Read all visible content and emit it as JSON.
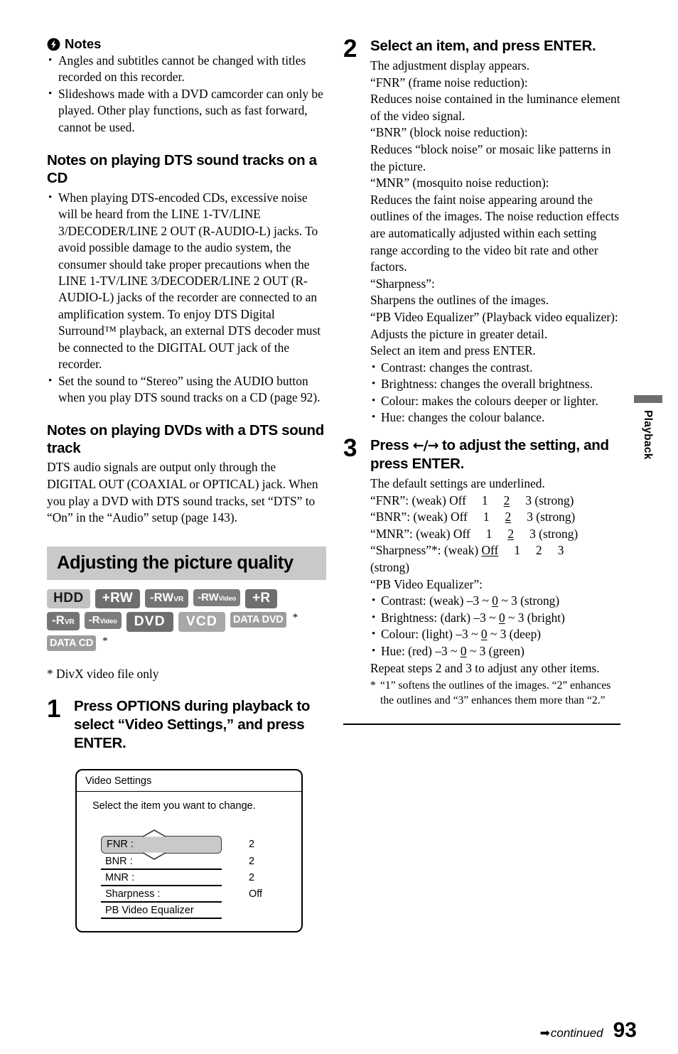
{
  "page": {
    "number": "93",
    "continued_label": "continued",
    "continued_icon": "right-arrow-icon",
    "side_tab_label": "Playback"
  },
  "left_column": {
    "notes_block": {
      "icon": "note-bolt-icon",
      "title": "Notes",
      "items": [
        "Angles and subtitles cannot be changed with titles recorded on this recorder.",
        "Slideshows made with a DVD camcorder can only be played. Other play functions, such as fast forward, cannot be used."
      ]
    },
    "dts_cd_section": {
      "heading": "Notes on playing DTS sound tracks on a CD",
      "items": [
        "When playing DTS-encoded CDs, excessive noise will be heard from the LINE 1-TV/LINE 3/DECODER/LINE 2 OUT (R-AUDIO-L) jacks. To avoid possible damage to the audio system, the consumer should take proper precautions when the LINE 1-TV/LINE 3/DECODER/LINE 2 OUT (R-AUDIO-L) jacks of the recorder are connected to an amplification system. To enjoy DTS Digital Surround™ playback, an external DTS decoder must be connected to the DIGITAL OUT jack of the recorder.",
        "Set the sound to “Stereo” using the AUDIO button when you play DTS sound tracks on a CD (page 92)."
      ]
    },
    "dts_dvd_section": {
      "heading": "Notes on playing DVDs with a DTS sound track",
      "body": "DTS audio signals are output only through the DIGITAL OUT (COAXIAL or OPTICAL) jack. When you play a DVD with DTS sound tracks, set “DTS” to “On” in the “Audio” setup (page 143)."
    },
    "banner_heading": "Adjusting the picture quality",
    "disc_badges": [
      {
        "label": "HDD",
        "style": "b-hdd",
        "star": false
      },
      {
        "label": "+RW",
        "style": "b-dark",
        "star": false
      },
      {
        "label": "-RW",
        "sub": "VR",
        "style": "b-mid",
        "star": false
      },
      {
        "label": "-RW",
        "sub": "Video",
        "style": "b-small",
        "star": false
      },
      {
        "label": "+R",
        "style": "b-dark",
        "star": false
      },
      {
        "label": "-R",
        "sub": "VR",
        "style": "b-mid",
        "star": false
      },
      {
        "label": "-R",
        "sub": "Video",
        "style": "b-small",
        "star": false
      },
      {
        "label": "DVD",
        "style": "b-dvd",
        "star": false
      },
      {
        "label": "VCD",
        "style": "b-vcd",
        "star": false
      },
      {
        "label": "DATA DVD",
        "style": "b-data",
        "star": true
      },
      {
        "label": "DATA CD",
        "style": "b-data",
        "star": true
      }
    ],
    "divx_footnote": "* DivX video file only",
    "step1": {
      "number": "1",
      "title": "Press OPTIONS during playback to select “Video Settings,” and press ENTER."
    },
    "video_settings_dialog": {
      "title": "Video Settings",
      "subtitle": "Select the item you want to change.",
      "rows": [
        {
          "label": "FNR :",
          "value": "2",
          "selected": true
        },
        {
          "label": "BNR :",
          "value": "2",
          "selected": false
        },
        {
          "label": "MNR :",
          "value": "2",
          "selected": false
        },
        {
          "label": "Sharpness :",
          "value": "Off",
          "selected": false
        },
        {
          "label": "PB Video Equalizer",
          "value": "",
          "selected": false
        }
      ]
    }
  },
  "right_column": {
    "step2": {
      "number": "2",
      "title": "Select an item, and press ENTER.",
      "lines": [
        "The adjustment display appears.",
        "“FNR” (frame noise reduction):",
        "Reduces noise contained in the luminance element of the video signal.",
        "“BNR” (block noise reduction):",
        "Reduces “block noise” or mosaic like patterns in the picture.",
        "“MNR” (mosquito noise reduction):",
        "Reduces the faint noise appearing around the outlines of the images. The noise reduction effects are automatically adjusted within each setting range according to the video bit rate and other factors.",
        "“Sharpness”:",
        "Sharpens the outlines of the images.",
        "“PB Video Equalizer” (Playback video equalizer):",
        "Adjusts the picture in greater detail.",
        "Select an item and press ENTER."
      ],
      "bullets": [
        "Contrast: changes the contrast.",
        "Brightness: changes the overall brightness.",
        "Colour: makes the colours deeper or lighter.",
        "Hue: changes the colour balance."
      ]
    },
    "step3": {
      "number": "3",
      "title_pre": "Press ",
      "title_arrows": "←/→",
      "title_post": " to adjust the setting, and press ENTER.",
      "intro": "The default settings are underlined.",
      "settings": [
        {
          "name": "“FNR”:",
          "low": "(weak) Off",
          "opt1": "1",
          "opt2": "2",
          "opt3": "3 (strong)",
          "default_index": 2
        },
        {
          "name": "“BNR”:",
          "low": "(weak) Off",
          "opt1": "1",
          "opt2": "2",
          "opt3": "3 (strong)",
          "default_index": 2
        },
        {
          "name": "“MNR”:",
          "low": "(weak) Off",
          "opt1": "1",
          "opt2": "2",
          "opt3": "3 (strong)",
          "default_index": 2
        },
        {
          "name": "“Sharpness”*:",
          "low": "(weak)",
          "opt0": "Off",
          "opt1": "1",
          "opt2": "2",
          "opt3": "3",
          "tail": "(strong)",
          "default_index": 0
        }
      ],
      "equalizer_title": "“PB Video Equalizer”:",
      "equalizer": [
        {
          "label": "Contrast:",
          "low": "(weak) –3",
          "mid": "0",
          "high": "3 (strong)"
        },
        {
          "label": "Brightness:",
          "low": "(dark) –3",
          "mid": "0",
          "high": "3 (bright)"
        },
        {
          "label": "Colour:",
          "low": "(light) –3",
          "mid": "0",
          "high": "3 (deep)"
        },
        {
          "label": "Hue:",
          "low": "(red) –3",
          "mid": "0",
          "high": "3 (green)"
        }
      ],
      "repeat_note": "Repeat steps 2 and 3 to adjust any other items.",
      "star_note": "“1” softens the outlines of the images. “2” enhances the outlines and “3” enhances them more than “2.”"
    }
  }
}
